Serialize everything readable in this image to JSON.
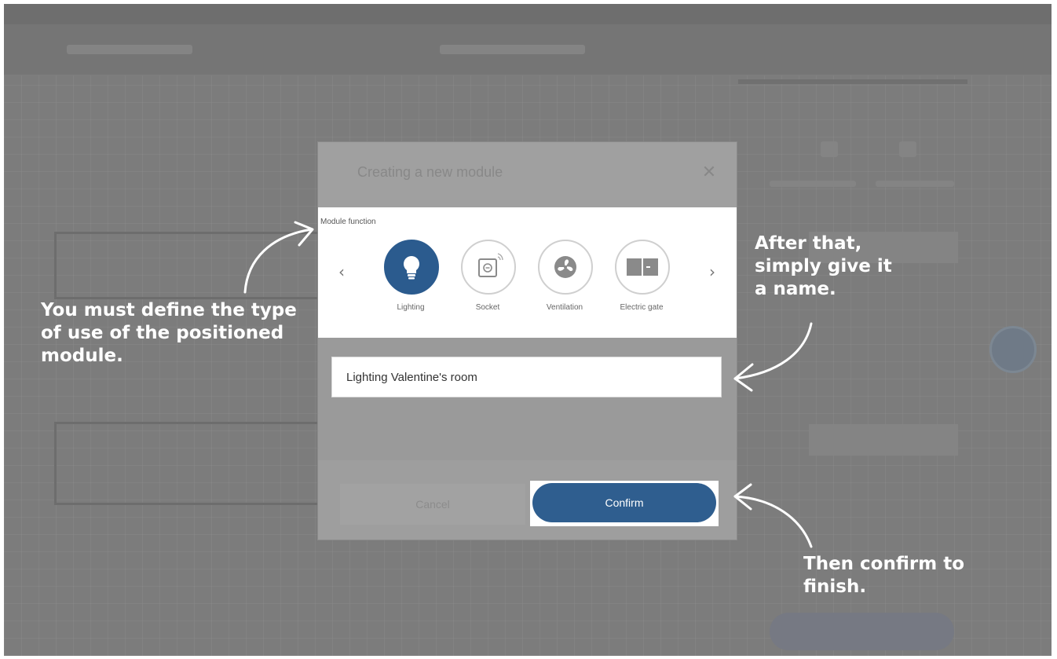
{
  "dialog": {
    "title": "Creating a new module",
    "function_label": "Module function",
    "functions": [
      {
        "label": "Lighting",
        "icon": "lightbulb-icon",
        "selected": true
      },
      {
        "label": "Socket",
        "icon": "socket-icon",
        "selected": false
      },
      {
        "label": "Ventilation",
        "icon": "fan-icon",
        "selected": false
      },
      {
        "label": "Electric gate",
        "icon": "gate-icon",
        "selected": false
      }
    ],
    "name_value": "Lighting Valentine's room",
    "cancel_label": "Cancel",
    "confirm_label": "Confirm"
  },
  "annotations": {
    "type_line1": "You must define the type",
    "type_line2": "of use of the positioned",
    "type_line3": "module.",
    "name_line1": "After that,",
    "name_line2": "simply give it",
    "name_line3": "a name.",
    "confirm_line1": "Then confirm to",
    "confirm_line2": "finish."
  },
  "colors": {
    "accent": "#2f5e8f",
    "overlay": "#7c7c7c"
  }
}
